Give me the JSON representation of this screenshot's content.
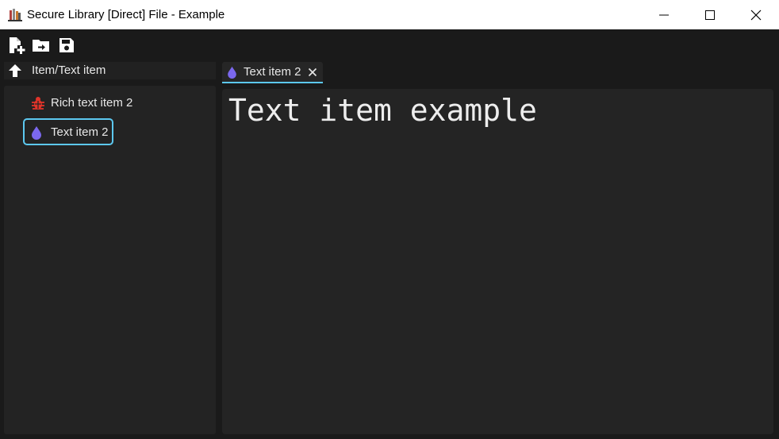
{
  "window": {
    "title": "Secure Library [Direct] File - Example"
  },
  "toolbar": {
    "buttons": [
      {
        "icon": "new-file-icon"
      },
      {
        "icon": "open-folder-icon"
      },
      {
        "icon": "save-icon"
      }
    ]
  },
  "sidebar": {
    "path": "Item/Text item",
    "items": [
      {
        "label": "Rich text item 2",
        "icon": "bug-icon",
        "icon_color": "#e0342a"
      },
      {
        "label": "Text item 2",
        "icon": "drop-icon",
        "icon_color": "#7b68ee",
        "selected": true
      }
    ]
  },
  "editor": {
    "tab": {
      "label": "Text item 2",
      "icon": "drop-icon"
    },
    "content": "Text item example"
  },
  "colors": {
    "accent": "#5cc8f0",
    "background": "#1a1a1a",
    "panel": "#232323",
    "text": "#e8e8e8",
    "drop": "#7b68ee",
    "bug": "#e0342a"
  }
}
